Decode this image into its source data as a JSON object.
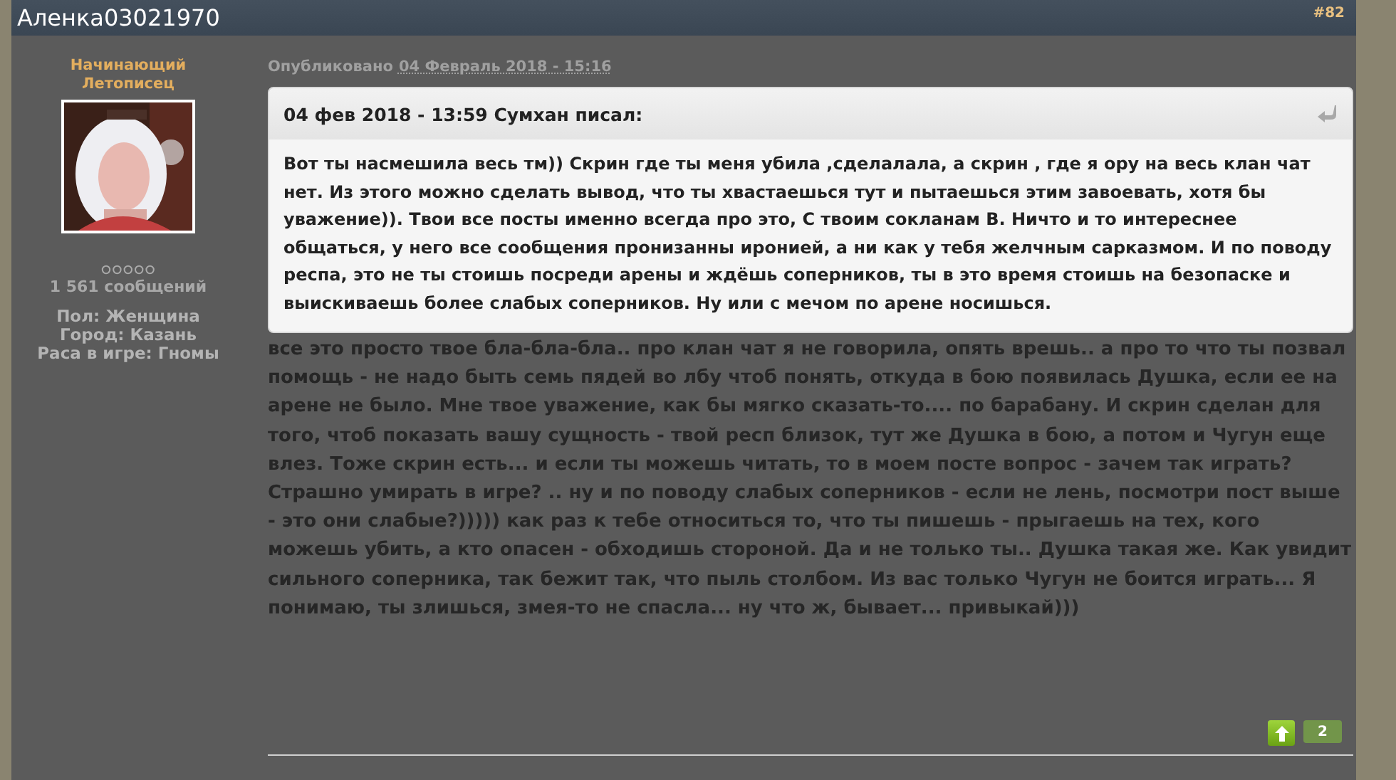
{
  "post": {
    "author": "Аленка03021970",
    "number": "#82"
  },
  "author_panel": {
    "rank": "Начинающий Летописец",
    "post_count": "1 561 сообщений",
    "details": [
      "Пол: Женщина",
      "Город: Казань",
      "Раса в игре: Гномы"
    ]
  },
  "published": {
    "label": "Опубликовано",
    "date": "04 Февраль 2018 - 15:16"
  },
  "quote": {
    "header": "04 фев 2018 - 13:59 Сумхан писал:",
    "text": "Вот ты насмешила весь тм)) Скрин где ты меня убила ,сделалала, а скрин , где я ору на весь клан чат нет. Из этого можно сделать вывод, что ты хвастаешься тут и пытаешься этим завоевать, хотя бы уважение)). Твои все посты именно всегда про это, С твоим сокланам В. Ничто и то интереснее общаться, у него все сообщения пронизанны иронией, а ни как у тебя желчным сарказмом. И по поводу респа, это не ты стоишь посреди арены и ждёшь соперников, ты в это время стоишь на безопаске и выискиваешь более слабых соперников. Ну или с мечом по арене носишься."
  },
  "body": "все это просто твое бла-бла-бла.. про клан чат я не говорила, опять врешь.. а про то что ты позвал помощь - не надо быть семь пядей во лбу чтоб понять, откуда в бою появилась Душка, если ее на арене не было. Мне твое уважение, как бы мягко сказать-то.... по барабану. И скрин сделан для того, чтоб показать вашу сущность - твой респ близок, тут же Душка в бою, а потом и Чугун еще влез. Тоже скрин есть... и если ты можешь читать, то в моем посте вопрос - зачем так играть? Страшно умирать в игре? .. ну и по поводу слабых соперников - если не лень, посмотри пост выше - это они слабые?))))) как раз к тебе относиться то, что ты пишешь - прыгаешь на тех, кого можешь убить, а кто опасен - обходишь стороной. Да и не только ты.. Душка такая же. Как увидит сильного соперника, так бежит так, что пыль столбом. Из вас только Чугун не боится играть... Я понимаю, ты злишься, змея-то не спасла... ну что ж, бывает... привыкай)))",
  "votes": {
    "count": "2"
  }
}
